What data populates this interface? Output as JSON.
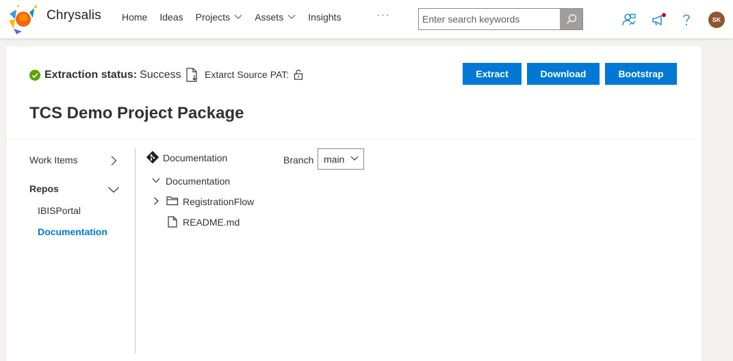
{
  "app": {
    "title": "Chrysalis"
  },
  "nav": {
    "items": [
      {
        "label": "Home",
        "dropdown": false
      },
      {
        "label": "Ideas",
        "dropdown": false
      },
      {
        "label": "Projects",
        "dropdown": true
      },
      {
        "label": "Assets",
        "dropdown": true
      },
      {
        "label": "Insights",
        "dropdown": false
      }
    ],
    "more": "···"
  },
  "search": {
    "placeholder": "Enter search keywords",
    "value": ""
  },
  "header_icons": [
    "people-icon",
    "notification-megaphone-icon",
    "help-icon"
  ],
  "user": {
    "initials": "SK",
    "avatar_color": "#8e562e"
  },
  "extraction": {
    "status_label": "Extraction status:",
    "status_value": "Success",
    "pat_label": "Extarct Source PAT:"
  },
  "actions": {
    "extract": "Extract",
    "download": "Download",
    "bootstrap": "Bootstrap"
  },
  "page": {
    "title": "TCS Demo Project Package"
  },
  "sidebar": {
    "items": [
      {
        "label": "Work Items",
        "expanded": false
      },
      {
        "label": "Repos",
        "expanded": true
      }
    ],
    "repos": [
      {
        "label": "IBISPortal",
        "active": false
      },
      {
        "label": "Documentation",
        "active": true
      }
    ]
  },
  "repo": {
    "name": "Documentation",
    "branch_label": "Branch",
    "branch_value": "main",
    "tree": {
      "root": "Documentation",
      "children": [
        {
          "type": "folder",
          "name": "RegistrationFlow"
        },
        {
          "type": "file",
          "name": "README.md"
        }
      ]
    }
  },
  "colors": {
    "primary": "#0078d4",
    "success": "#57a300",
    "unread_dot": "#c50f1f"
  }
}
